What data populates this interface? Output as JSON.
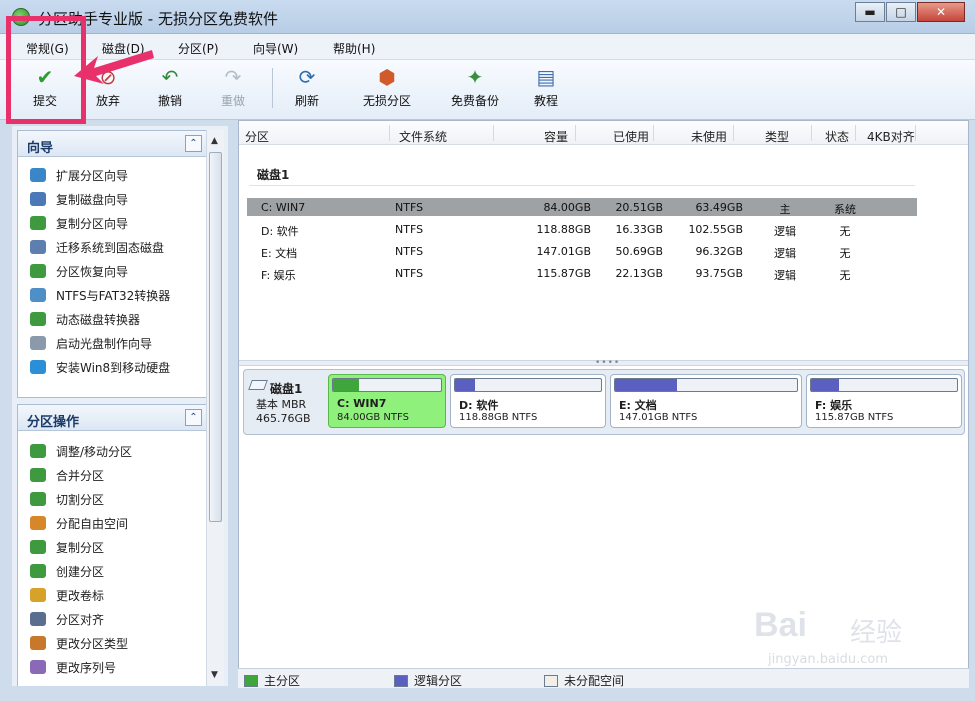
{
  "window": {
    "title": "分区助手专业版 - 无损分区免费软件",
    "buttons": {
      "minimize": "▬",
      "maximize": "□",
      "close": "✕"
    }
  },
  "menubar": [
    {
      "label": "常规(G)"
    },
    {
      "label": "磁盘(D)"
    },
    {
      "label": "分区(P)"
    },
    {
      "label": "向导(W)"
    },
    {
      "label": "帮助(H)"
    }
  ],
  "toolbar": [
    {
      "label": "提交",
      "icon": "check-icon",
      "glyph": "✔",
      "color": "#2f9a2f"
    },
    {
      "label": "放弃",
      "icon": "discard-icon",
      "glyph": "⊘",
      "color": "#c33a3a"
    },
    {
      "label": "撤销",
      "icon": "undo-icon",
      "glyph": "↶",
      "color": "#2f8a3a"
    },
    {
      "label": "重做",
      "icon": "redo-icon",
      "glyph": "↷",
      "color": "#aab2bc",
      "disabled": true
    },
    {
      "label": "刷新",
      "icon": "refresh-icon",
      "glyph": "⟳",
      "color": "#2d6fb2"
    },
    {
      "label": "无损分区",
      "icon": "lossless-partition-icon",
      "glyph": "⬢",
      "color": "#d05a2a"
    },
    {
      "label": "免费备份",
      "icon": "backup-icon",
      "glyph": "✦",
      "color": "#3a8f3a"
    },
    {
      "label": "教程",
      "icon": "tutorial-icon",
      "glyph": "▤",
      "color": "#3f6fb0"
    }
  ],
  "wizard_group": {
    "title": "向导",
    "collapse_glyph": "⌃",
    "items": [
      {
        "label": "扩展分区向导",
        "icon": "extend-partition-icon",
        "color": "#3a86c8"
      },
      {
        "label": "复制磁盘向导",
        "icon": "copy-disk-icon",
        "color": "#4a78b8"
      },
      {
        "label": "复制分区向导",
        "icon": "copy-partition-icon",
        "color": "#3f9a3f"
      },
      {
        "label": "迁移系统到固态磁盘",
        "icon": "migrate-os-icon",
        "color": "#5c7fb0"
      },
      {
        "label": "分区恢复向导",
        "icon": "recover-partition-icon",
        "color": "#3f9a3f"
      },
      {
        "label": "NTFS与FAT32转换器",
        "icon": "ntfs-fat32-icon",
        "color": "#4f8fc8"
      },
      {
        "label": "动态磁盘转换器",
        "icon": "dynamic-disk-icon",
        "color": "#3f9a3f"
      },
      {
        "label": "启动光盘制作向导",
        "icon": "boot-cd-icon",
        "color": "#8a9aab"
      },
      {
        "label": "安装Win8到移动硬盘",
        "icon": "win8-icon",
        "color": "#2a8fd6"
      }
    ]
  },
  "partition_ops_group": {
    "title": "分区操作",
    "collapse_glyph": "⌃",
    "items": [
      {
        "label": "调整/移动分区",
        "icon": "resize-move-icon",
        "color": "#3f9a3f"
      },
      {
        "label": "合并分区",
        "icon": "merge-icon",
        "color": "#3f9a3f"
      },
      {
        "label": "切割分区",
        "icon": "split-icon",
        "color": "#3f9a3f"
      },
      {
        "label": "分配自由空间",
        "icon": "allocate-space-icon",
        "color": "#d7862a"
      },
      {
        "label": "复制分区",
        "icon": "copy-partition-op-icon",
        "color": "#3f9a3f"
      },
      {
        "label": "创建分区",
        "icon": "create-partition-icon",
        "color": "#3f9a3f"
      },
      {
        "label": "更改卷标",
        "icon": "change-label-icon",
        "color": "#d7a22a"
      },
      {
        "label": "分区对齐",
        "icon": "align-icon",
        "color": "#5a6f8f"
      },
      {
        "label": "更改分区类型",
        "icon": "change-type-icon",
        "color": "#c8782a"
      },
      {
        "label": "更改序列号",
        "icon": "change-serial-icon",
        "color": "#8a6ab8"
      }
    ]
  },
  "table": {
    "columns": [
      "分区",
      "文件系统",
      "容量",
      "已使用",
      "未使用",
      "类型",
      "状态",
      "4KB对齐"
    ],
    "disk_label": "磁盘1",
    "rows": [
      {
        "partition": "C: WIN7",
        "fs": "NTFS",
        "capacity": "84.00GB",
        "used": "20.51GB",
        "unused": "63.49GB",
        "type": "主",
        "status": "系统",
        "selected": true
      },
      {
        "partition": "D: 软件",
        "fs": "NTFS",
        "capacity": "118.88GB",
        "used": "16.33GB",
        "unused": "102.55GB",
        "type": "逻辑",
        "status": "无"
      },
      {
        "partition": "E: 文档",
        "fs": "NTFS",
        "capacity": "147.01GB",
        "used": "50.69GB",
        "unused": "96.32GB",
        "type": "逻辑",
        "status": "无"
      },
      {
        "partition": "F: 娱乐",
        "fs": "NTFS",
        "capacity": "115.87GB",
        "used": "22.13GB",
        "unused": "93.75GB",
        "type": "逻辑",
        "status": "无"
      }
    ]
  },
  "disk_map": {
    "disk": {
      "name": "磁盘1",
      "type": "基本 MBR",
      "size": "465.76GB"
    },
    "partitions": [
      {
        "name": "C: WIN7",
        "info": "84.00GB NTFS",
        "used_fraction": 0.24,
        "fill_color": "#3ea63a",
        "selected": true
      },
      {
        "name": "D: 软件",
        "info": "118.88GB NTFS",
        "used_fraction": 0.14,
        "fill_color": "#5a5fc0"
      },
      {
        "name": "E: 文档",
        "info": "147.01GB NTFS",
        "used_fraction": 0.34,
        "fill_color": "#5a5fc0"
      },
      {
        "name": "F: 娱乐",
        "info": "115.87GB NTFS",
        "used_fraction": 0.19,
        "fill_color": "#5a5fc0"
      }
    ]
  },
  "legend": [
    {
      "label": "主分区",
      "color": "#3ea63a"
    },
    {
      "label": "逻辑分区",
      "color": "#5a5fc0"
    },
    {
      "label": "未分配空间",
      "color": "#f4efe6"
    }
  ],
  "watermark": {
    "logo": "Bai",
    "text": "经验",
    "url": "jingyan.baidu.com"
  },
  "colors": {
    "highlight": "#e8306b",
    "selected_row": "#9fa2a5",
    "selected_block": "#8ff07c"
  }
}
